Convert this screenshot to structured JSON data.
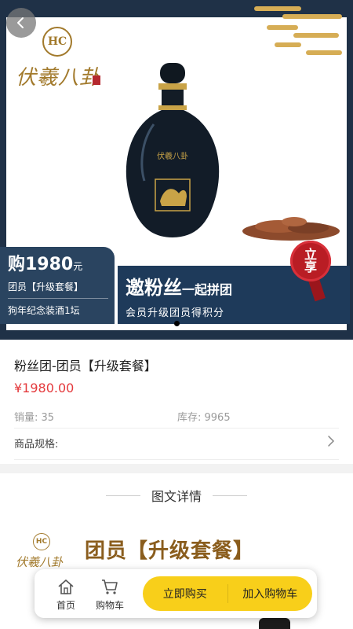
{
  "banner": {
    "brand_logo_text": "伏羲八卦",
    "brand_logo_mark": "HC",
    "price_main": "购1980",
    "price_unit": "元",
    "price_sub": "团员【升级套餐】",
    "price_desc": "狗年纪念装酒1坛",
    "promo_title": "邀粉丝",
    "promo_title_suffix": "一起拼团",
    "promo_sub": "会员升级团员得积分",
    "seal_text_line1": "立",
    "seal_text_line2": "享",
    "bottle_label": "伏羲八卦",
    "accent_color": "#1f3147",
    "gold_color": "#a27a2c"
  },
  "product": {
    "title": "粉丝团-团员【升级套餐】",
    "price": "¥1980.00",
    "sales_label": "销量: 35",
    "stock_label": "库存: 9965",
    "spec_label": "商品规格:",
    "price_color": "#e4393c"
  },
  "details": {
    "section_title": "图文详情",
    "logo_text": "伏羲八卦",
    "logo_mark": "HC",
    "heading": "团员【升级套餐】"
  },
  "bottom_bar": {
    "home_label": "首页",
    "cart_label": "购物车",
    "buy_now_label": "立即购买",
    "add_cart_label": "加入购物车",
    "cta_color": "#f8cf1a"
  },
  "icons": {
    "back": "chevron-left-icon",
    "home": "home-icon",
    "cart": "cart-icon",
    "spec_arrow": "chevron-right-icon"
  }
}
